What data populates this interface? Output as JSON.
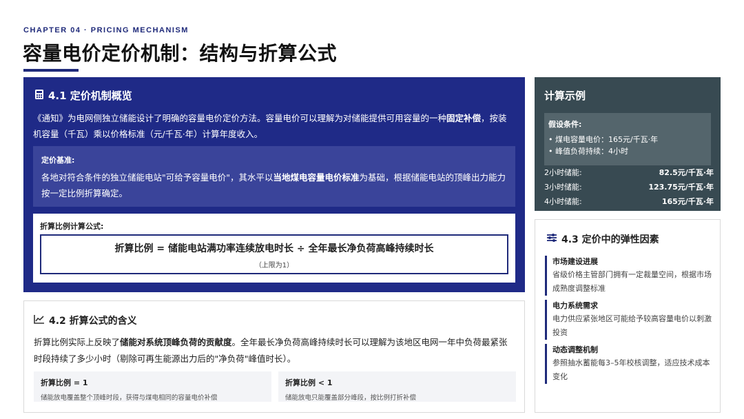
{
  "header": {
    "chapter": "CHAPTER 04 · PRICING MECHANISM",
    "title": "容量电价定价机制：结构与折算公式"
  },
  "section41": {
    "title": "4.1 定价机制概览",
    "icon": "calculator-icon",
    "intro_a": "《通知》为电网侧独立储能设计了明确的容量电价定价方法。容量电价可以理解为对储能提供可用容量的一种",
    "intro_bold": "固定补偿",
    "intro_b": "，按装机容量（千瓦）乘以价格标准（元/千瓦·年）计算年度收入。",
    "basis_title": "定价基准:",
    "basis_a": "各地对符合条件的独立储能电站\"可给予容量电价\"，其水平以",
    "basis_bold": "当地煤电容量电价标准",
    "basis_b": "为基础，根据储能电站的顶峰出力能力按一定比例折算确定。",
    "formula_label": "折算比例计算公式:",
    "formula": "折算比例 = 储能电站满功率连续放电时长 ÷ 全年最长净负荷高峰持续时长",
    "formula_note": "（上限为1）"
  },
  "section42": {
    "title": "4.2 折算公式的含义",
    "icon": "line-chart-icon",
    "text_a": "折算比例实际上反映了",
    "text_bold": "储能对系统顶峰负荷的贡献度",
    "text_b": "。全年最长净负荷高峰持续时长可以理解为该地区电网一年中负荷最紧张时段持续了多少小时（剔除可再生能源出力后的\"净负荷\"峰值时长）。",
    "cases": [
      {
        "title": "折算比例 = 1",
        "desc": "储能放电覆盖整个顶峰时段，获得与煤电相同的容量电价补偿"
      },
      {
        "title": "折算比例 < 1",
        "desc": "储能放电只能覆盖部分峰段，按比例打折补偿"
      }
    ]
  },
  "example": {
    "title": "计算示例",
    "assume_title": "假设条件:",
    "assumptions": [
      "• 煤电容量电价：165元/千瓦·年",
      "• 峰值负荷持续：4小时"
    ],
    "rows": [
      {
        "label": "2小时储能:",
        "value": "82.5元/千瓦·年"
      },
      {
        "label": "3小时储能:",
        "value": "123.75元/千瓦·年"
      },
      {
        "label": "4小时储能:",
        "value": "165元/千瓦·年"
      }
    ]
  },
  "section43": {
    "title": "4.3 定价中的弹性因素",
    "icon": "sliders-icon",
    "factors": [
      {
        "title": "市场建设进展",
        "desc": "省级价格主管部门拥有一定裁量空间，根据市场成熟度调整标准"
      },
      {
        "title": "电力系统需求",
        "desc": "电力供应紧张地区可能给予较高容量电价以刺激投资"
      },
      {
        "title": "动态调整机制",
        "desc": "参照抽水蓄能每3–5年校核调整，适应技术成本变化"
      }
    ]
  }
}
